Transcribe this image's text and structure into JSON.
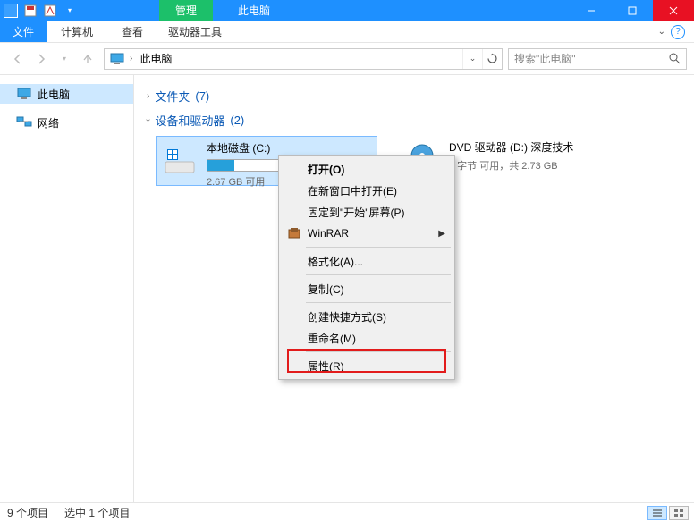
{
  "titlebar": {
    "context_tab": "管理",
    "window_title": "此电脑"
  },
  "ribbon": {
    "file": "文件",
    "computer": "计算机",
    "view": "查看",
    "drive_tools": "驱动器工具"
  },
  "nav": {
    "breadcrumb_root": "此电脑",
    "search_placeholder": "搜索\"此电脑\""
  },
  "sidebar": {
    "this_pc": "此电脑",
    "network": "网络"
  },
  "groups": {
    "folders_label": "文件夹",
    "folders_count": "(7)",
    "devices_label": "设备和驱动器",
    "devices_count": "(2)"
  },
  "drives": {
    "c": {
      "name": "本地磁盘 (C:)",
      "sub": "2.67 GB 可用",
      "fill_pct": 18
    },
    "d": {
      "name": "DVD 驱动器 (D:) 深度技术",
      "sub": "0 字节 可用，共 2.73 GB"
    }
  },
  "context_menu": {
    "open": "打开(O)",
    "open_new": "在新窗口中打开(E)",
    "pin_start": "固定到\"开始\"屏幕(P)",
    "winrar": "WinRAR",
    "format": "格式化(A)...",
    "copy": "复制(C)",
    "create_shortcut": "创建快捷方式(S)",
    "rename": "重命名(M)",
    "properties": "属性(R)"
  },
  "status": {
    "items": "9 个项目",
    "selected": "选中 1 个项目"
  }
}
